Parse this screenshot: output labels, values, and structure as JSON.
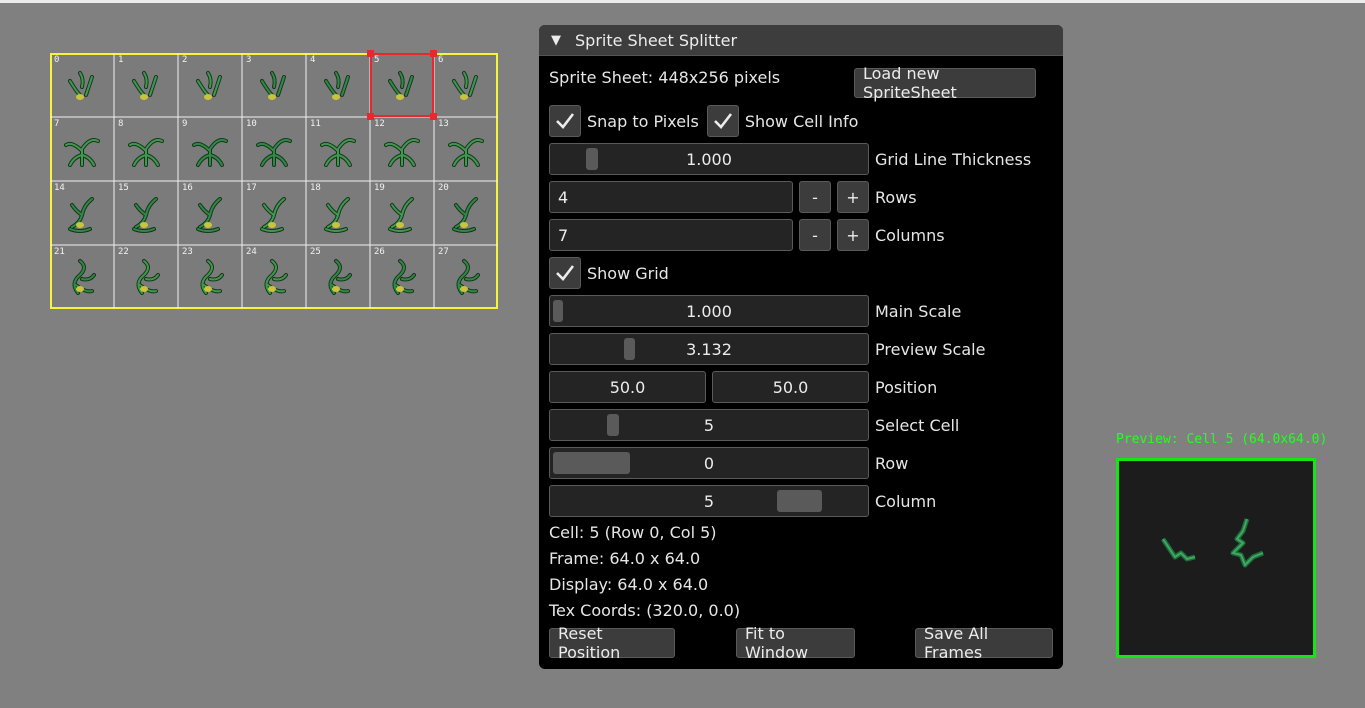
{
  "sheet": {
    "cells": [
      "0",
      "1",
      "2",
      "3",
      "4",
      "5",
      "6",
      "7",
      "8",
      "9",
      "10",
      "11",
      "12",
      "13",
      "14",
      "15",
      "16",
      "17",
      "18",
      "19",
      "20",
      "21",
      "22",
      "23",
      "24",
      "25",
      "26",
      "27"
    ],
    "selected_cell": 5
  },
  "panel": {
    "title": "Sprite Sheet Splitter",
    "sheet_info": "Sprite Sheet: 448x256 pixels",
    "load_button": "Load new SpriteSheet",
    "snap_label": "Snap to Pixels",
    "show_cell_info_label": "Show Cell Info",
    "grid_thickness": {
      "value": "1.000",
      "label": "Grid Line Thickness"
    },
    "rows": {
      "value": "4",
      "label": "Rows",
      "minus": "-",
      "plus": "+"
    },
    "columns": {
      "value": "7",
      "label": "Columns",
      "minus": "-",
      "plus": "+"
    },
    "show_grid_label": "Show Grid",
    "main_scale": {
      "value": "1.000",
      "label": "Main Scale"
    },
    "preview_scale": {
      "value": "3.132",
      "label": "Preview Scale"
    },
    "position": {
      "x": "50.0",
      "y": "50.0",
      "label": "Position"
    },
    "select_cell": {
      "value": "5",
      "label": "Select Cell"
    },
    "row": {
      "value": "0",
      "label": "Row"
    },
    "column": {
      "value": "5",
      "label": "Column"
    },
    "cell_info": "Cell: 5 (Row 0, Col 5)",
    "frame_info": "Frame: 64.0 x 64.0",
    "display_info": "Display: 64.0 x 64.0",
    "tex_info": "Tex Coords: (320.0, 0.0)",
    "reset_button": "Reset Position",
    "fit_button": "Fit to Window",
    "save_button": "Save All Frames"
  },
  "preview": {
    "label": "Preview: Cell 5 (64.0x64.0)"
  },
  "colors": {
    "grid": "#f5f53a",
    "selection": "#e8282e",
    "preview_border": "#15e415"
  }
}
